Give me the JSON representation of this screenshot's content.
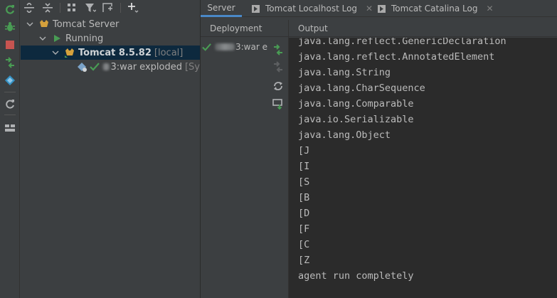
{
  "tree": {
    "tomcat_server": "Tomcat Server",
    "running": "Running",
    "tomcat_name": "Tomcat 8.5.82",
    "tomcat_local": "[local]",
    "artifact_suffix": "3:war exploded",
    "artifact_status": "[Sy"
  },
  "tabs": [
    {
      "label": "Server"
    },
    {
      "label": "Tomcat Localhost Log",
      "close": "✕"
    },
    {
      "label": "Tomcat Catalina Log",
      "close": "✕"
    }
  ],
  "deployment": {
    "header": "Deployment",
    "item_suffix": "3:war e"
  },
  "output": {
    "header": "Output",
    "lines": [
      "java.lang.reflect.GenericDeclaration",
      "java.lang.reflect.AnnotatedElement",
      "java.lang.String",
      "java.lang.CharSequence",
      "java.lang.Comparable",
      "java.io.Serializable",
      "java.lang.Object",
      "[J",
      "[I",
      "[S",
      "[B",
      "[D",
      "[F",
      "[C",
      "[Z",
      "agent run completely"
    ]
  },
  "colors": {
    "background": "#3c3f41",
    "console": "#2b2b2b",
    "selection": "#0d293e",
    "run_green": "#499c54",
    "stop_red": "#c75450",
    "accent_blue": "#4a88c7"
  }
}
